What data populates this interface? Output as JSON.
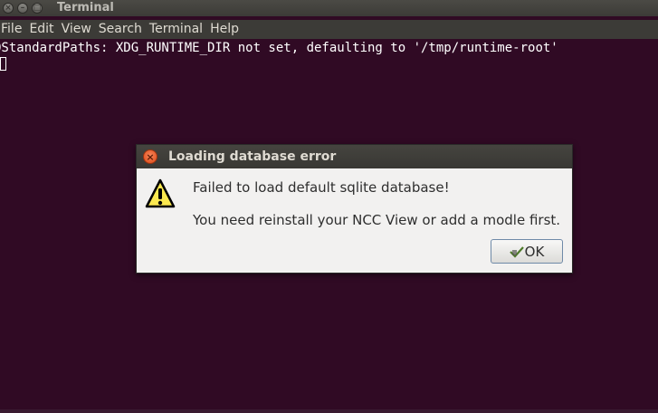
{
  "window": {
    "title": "Terminal",
    "close_glyph": "×",
    "minimize_glyph": "–",
    "maximize_glyph": "□"
  },
  "menubar": {
    "items": [
      "File",
      "Edit",
      "View",
      "Search",
      "Terminal",
      "Help"
    ]
  },
  "terminal": {
    "line1": "QStandardPaths: XDG_RUNTIME_DIR not set, defaulting to '/tmp/runtime-root'"
  },
  "dialog": {
    "title": "Loading database error",
    "close_glyph": "×",
    "message_primary": "Failed to load default sqlite database!",
    "message_secondary": "You need reinstall your NCC View or add a modle first.",
    "ok_label": "OK",
    "icon": "warning-icon"
  },
  "colors": {
    "terminal_bg": "#300a24",
    "menubar_bg": "#3c3b37",
    "dialog_bg": "#f2f1f0",
    "close_button": "#df4a16",
    "warning_yellow": "#fce94f"
  }
}
